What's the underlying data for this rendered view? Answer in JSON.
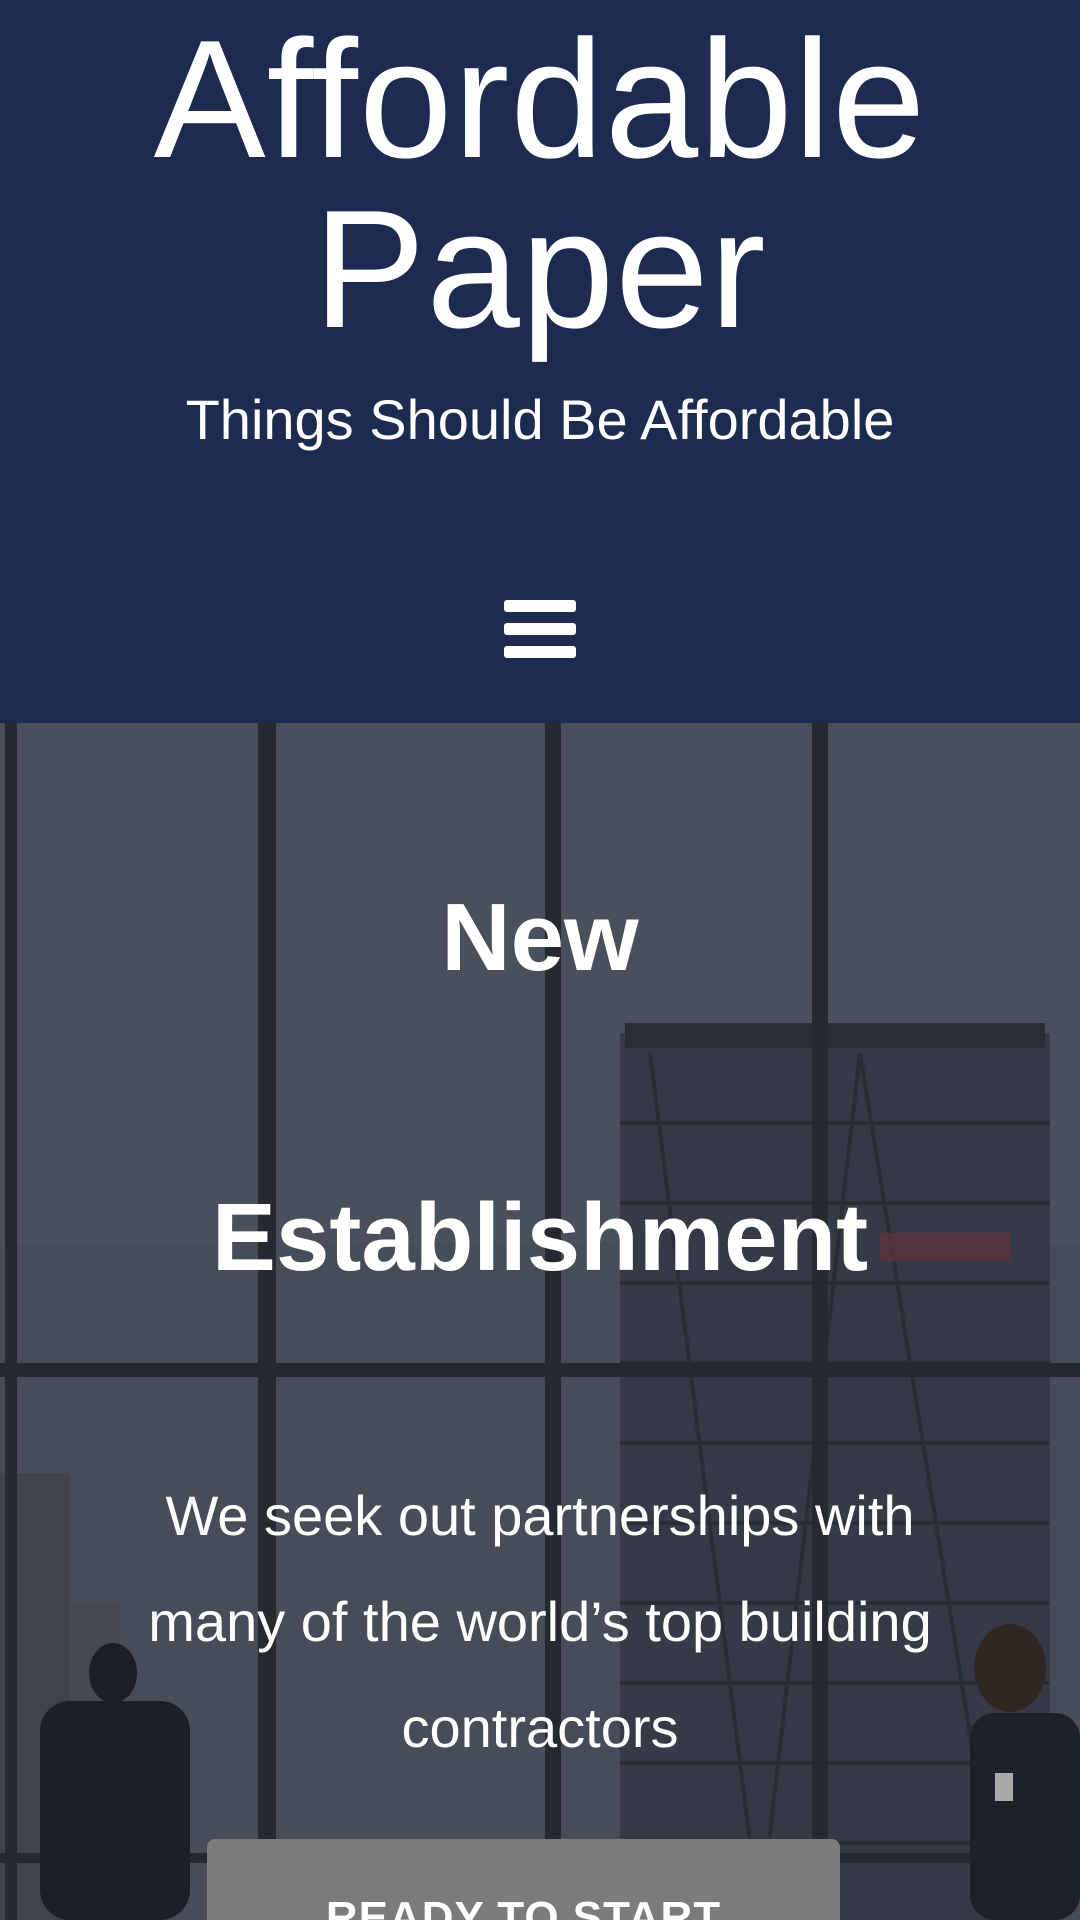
{
  "site": {
    "title_line1": "Affordable",
    "title_line2": "Paper",
    "tagline": "Things Should Be Affordable"
  },
  "nav": {
    "menu_icon": "hamburger-menu-icon"
  },
  "hero": {
    "heading_line1": "New",
    "heading_line2": "Establishment",
    "text": "We seek out partnerships with many of the world’s top building contractors",
    "cta_label": "READY TO START"
  },
  "colors": {
    "header_background": "#1c2b4f",
    "text": "#ffffff",
    "cta_background": "#7a7b7d"
  }
}
